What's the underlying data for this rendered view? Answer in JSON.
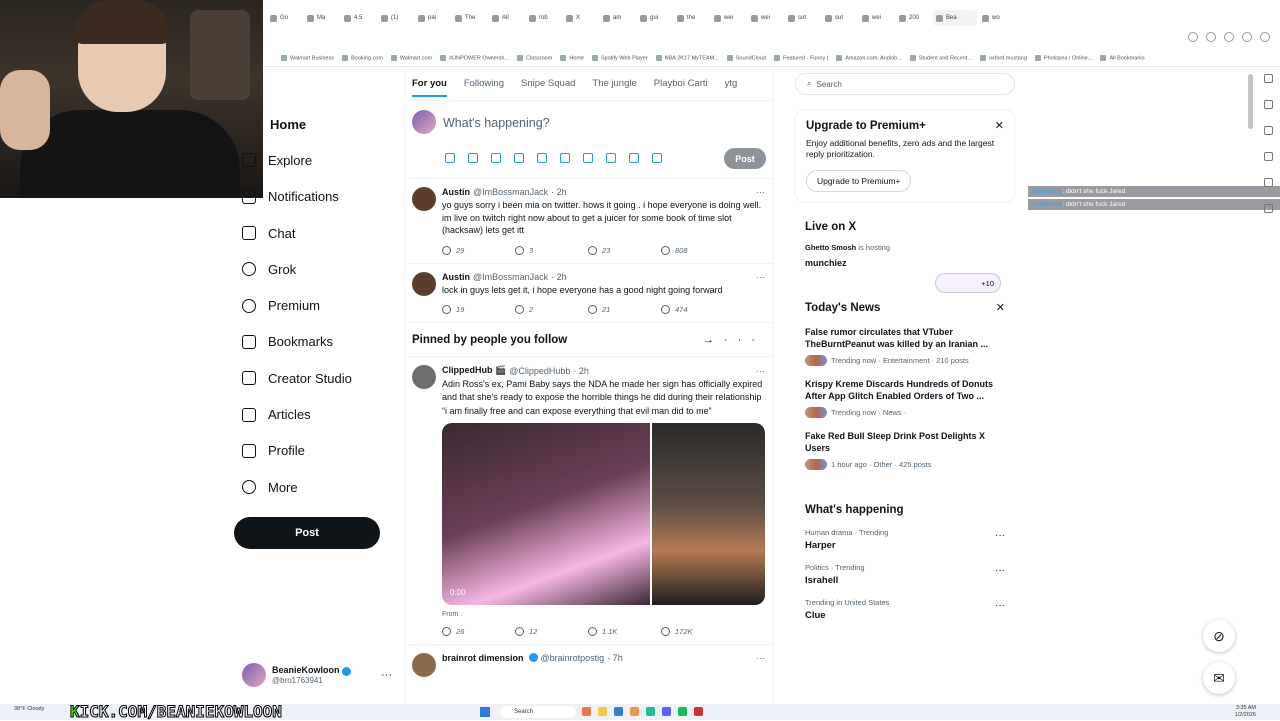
{
  "browser": {
    "tabs": [
      "Go",
      "Ma",
      "4.5",
      "(1)",
      "pal",
      "The",
      "All",
      "rob",
      "X",
      "am",
      "gui",
      "the",
      "wei",
      "wei",
      "sut",
      "sut",
      "wei",
      "200",
      "Bea",
      "wo"
    ],
    "bookmarks": [
      "Walmart Business",
      "Booking.com",
      "Walmart.com",
      "#UNPOWER Ownersh...",
      "Classroom",
      "Home",
      "Spotify Web Player",
      "NBA 2K17 MyTEAM...",
      "SoundCloud",
      "Featured - Funny |",
      "Amazon.com: Audiob...",
      "Student and Recent...",
      "oxford mustang",
      "Photopea | Online...",
      "All Bookmarks"
    ]
  },
  "sidebar": {
    "items": [
      {
        "label": "Home",
        "icon": "home-icon"
      },
      {
        "label": "Explore",
        "icon": "search-icon"
      },
      {
        "label": "Notifications",
        "icon": "bell-icon"
      },
      {
        "label": "Chat",
        "icon": "mail-icon"
      },
      {
        "label": "Grok",
        "icon": "grok-icon"
      },
      {
        "label": "Premium",
        "icon": "verified-icon"
      },
      {
        "label": "Bookmarks",
        "icon": "bookmark-icon"
      },
      {
        "label": "Creator Studio",
        "icon": "lightning-icon"
      },
      {
        "label": "Articles",
        "icon": "article-icon"
      },
      {
        "label": "Profile",
        "icon": "user-icon"
      },
      {
        "label": "More",
        "icon": "more-icon"
      }
    ],
    "post_label": "Post",
    "account": {
      "name": "BeanieKowloon",
      "handle": "@bro1763941"
    }
  },
  "feed": {
    "tabs": [
      "For you",
      "Following",
      "Snipe Squad",
      "The jungle",
      "Playboi Carti",
      "ytg"
    ],
    "composer_placeholder": "What's happening?",
    "composer_post": "Post",
    "tweets_top": [
      {
        "name": "Austin",
        "handle": "@ImBossmanJack",
        "time": "· 2h",
        "text": "yo guys sorry i been mia on twitter. hows it going . i hope everyone is doing well. im live on twitch right now about to get a juicer for some book of time slot (hacksaw) lets get itt",
        "replies": "29",
        "reposts": "3",
        "likes": "23",
        "views": "808"
      },
      {
        "name": "Austin",
        "handle": "@ImBossmanJack",
        "time": "· 2h",
        "text": "lock in guys lets get it, i hope everyone has a good night going forward",
        "replies": "19",
        "reposts": "2",
        "likes": "21",
        "views": "474"
      }
    ],
    "pinned_title": "Pinned by people you follow",
    "pinned_tweet": {
      "name": "ClippedHub 🎬",
      "handle": "@ClippedHubb",
      "time": "· 2h",
      "text": "Adin Ross's ex, Pami Baby says the NDA he made her sign has officially expired and that she's ready to expose the horrible things he did during their relationship",
      "quote": "“i am finally free and can expose everything that evil man did to me”",
      "video_time": "0:00",
      "from": "From .",
      "replies": "26",
      "reposts": "12",
      "likes": "1.1K",
      "views": "172K"
    },
    "next_tweet": {
      "name": "brainrot dimension",
      "handle": "@brainrotpostig",
      "time": "· 7h"
    }
  },
  "right": {
    "search_placeholder": "Search",
    "premium": {
      "title": "Upgrade to Premium+",
      "text": "Enjoy additional benefits, zero ads and the largest reply prioritization.",
      "button": "Upgrade to Premium+"
    },
    "live": {
      "title": "Live on X",
      "host": "Ghetto Smosh",
      "hosting": "is hosting",
      "space": "munchiez",
      "count": "+10"
    },
    "news": {
      "title": "Today's News",
      "items": [
        {
          "headline": "False rumor circulates that VTuber TheBurntPeanut was killed by an Iranian ...",
          "meta": "Trending now · Entertainment · 210 posts"
        },
        {
          "headline": "Krispy Kreme Discards Hundreds of Donuts After App Glitch Enabled Orders of Two ...",
          "meta": "Trending now · News ·"
        },
        {
          "headline": "Fake Red Bull Sleep Drink Post Delights X Users",
          "meta": "1 hour ago · Other · 425 posts"
        }
      ]
    },
    "happening": {
      "title": "What's happening",
      "items": [
        {
          "context": "Human drama · Trending",
          "name": "Harper"
        },
        {
          "context": "Politics · Trending",
          "name": "Israhell"
        },
        {
          "context": "Trending in United States",
          "name": "Clue"
        }
      ]
    }
  },
  "overlay": {
    "chat_lines": [
      {
        "user": "ucatkmoy",
        "text": ": didn't she fuck Jared"
      },
      {
        "user": "ucatkmoy",
        "text": ": didn't she fuck Jared"
      }
    ],
    "kick_prefix": "K",
    "kick_text": "ICK.COM/BEANIEKOWLOON"
  },
  "taskbar": {
    "search": "Search",
    "weather": "38°F Cloudy",
    "time": "3:35 AM",
    "date": "1/2/2026"
  }
}
